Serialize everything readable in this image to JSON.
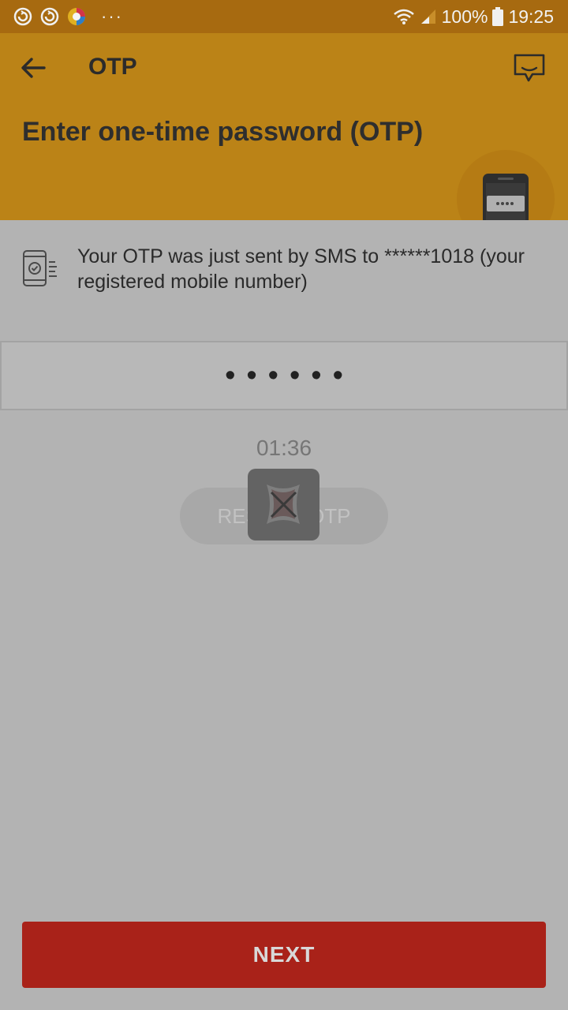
{
  "status_bar": {
    "left_icons": [
      "sync-icon",
      "sync-icon",
      "browser-icon"
    ],
    "more_indicator": "···",
    "battery_text": "100%",
    "time": "19:25"
  },
  "header": {
    "title": "OTP",
    "heading": "Enter one-time password (OTP)"
  },
  "info": {
    "message": "Your OTP was just sent by SMS to ******1018 (your registered mobile number)"
  },
  "otp_input": {
    "value": "••••••"
  },
  "timer": {
    "countdown": "01:36"
  },
  "resend": {
    "label": "RESEND OTP"
  },
  "next": {
    "label": "NEXT"
  },
  "colors": {
    "header_bg": "#bb8317",
    "status_bg": "#a76a10",
    "overlay_bg": "#b3b3b3",
    "next_bg": "#a92219"
  }
}
